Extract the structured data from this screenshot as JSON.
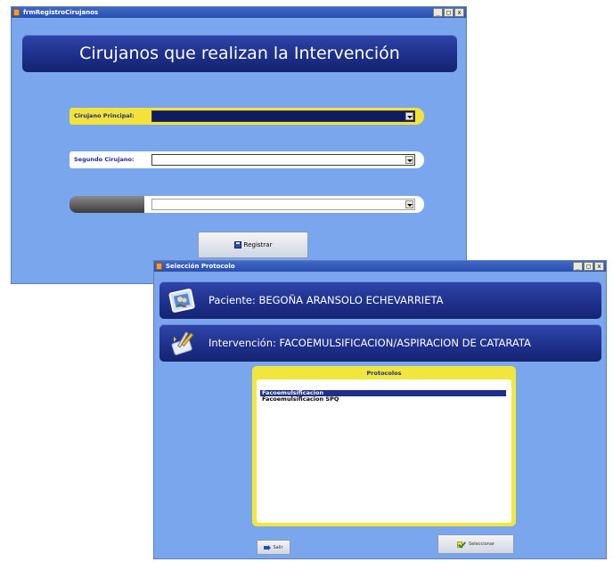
{
  "window1": {
    "title": "frmRegistroCirujanos",
    "controls": {
      "minimize": "_",
      "maximize": "□",
      "close": "x"
    },
    "header": "Cirujanos que realizan la Intervención",
    "fields": [
      {
        "label": "Cirujano Principal:",
        "value": ""
      },
      {
        "label": "Segundo Cirujano:",
        "value": ""
      },
      {
        "label": "",
        "value": ""
      }
    ],
    "register_button": {
      "label": "Registrar",
      "icon": "floppy-disk-icon"
    }
  },
  "window2": {
    "title": "Selección Protocolo",
    "controls": {
      "minimize": "_",
      "maximize": "□",
      "close": "x"
    },
    "patient": {
      "label": "Paciente: BEGOÑA ARANSOLO ECHEVARRIETA",
      "icon": "patient-photo-icon"
    },
    "intervention": {
      "label": "Intervención: FACOEMULSIFICACION/ASPIRACION DE CATARATA",
      "icon": "surgical-tools-icon"
    },
    "protocols": {
      "title": "Protocolos",
      "items": [
        "Facoemulsificacion",
        "Facoemulsificacion SPQ"
      ],
      "selected_index": 0
    },
    "exit_button": {
      "label": "Salir",
      "icon": "exit-arrow-icon"
    },
    "select_button": {
      "label": "Seleccionar",
      "icon": "select-check-icon"
    }
  },
  "colors": {
    "window_background": "#7aa6ee",
    "header_navy": "#1d2f8a",
    "highlight_yellow": "#f2e23a",
    "selection": "#1d2f8a"
  }
}
